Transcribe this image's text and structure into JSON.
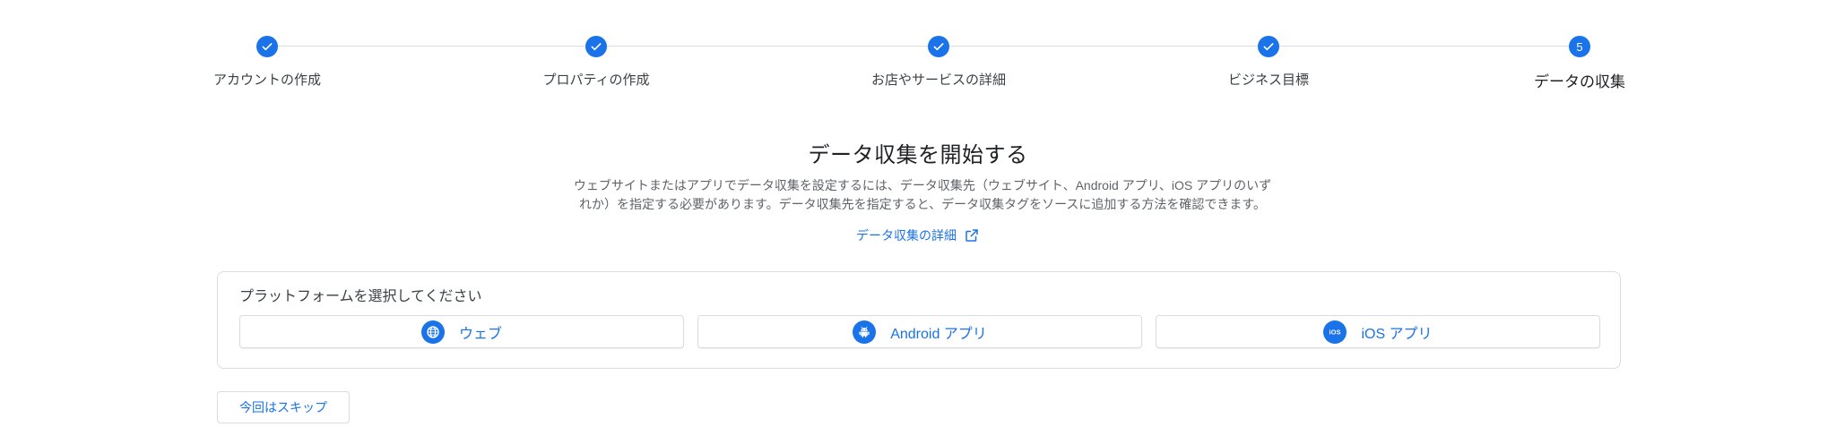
{
  "stepper": {
    "steps": [
      {
        "label": "アカウントの作成",
        "state": "done",
        "number": ""
      },
      {
        "label": "プロパティの作成",
        "state": "done",
        "number": ""
      },
      {
        "label": "お店やサービスの詳細",
        "state": "done",
        "number": ""
      },
      {
        "label": "ビジネス目標",
        "state": "done",
        "number": ""
      },
      {
        "label": "データの収集",
        "state": "current",
        "number": "5"
      }
    ]
  },
  "main": {
    "title": "データ収集を開始する",
    "description_line1": "ウェブサイトまたはアプリでデータ収集を設定するには、データ収集先（ウェブサイト、Android アプリ、iOS アプリのいず",
    "description_line2": "れか）を指定する必要があります。データ収集先を指定すると、データ収集タグをソースに追加する方法を確認できます。",
    "learn_more": "データ収集の詳細"
  },
  "platform_card": {
    "title": "プラットフォームを選択してください",
    "buttons": [
      {
        "label": "ウェブ",
        "icon": "globe-icon"
      },
      {
        "label": "Android アプリ",
        "icon": "android-icon"
      },
      {
        "label": "iOS アプリ",
        "icon": "ios-icon"
      }
    ]
  },
  "footer": {
    "skip_label": "今回はスキップ"
  },
  "colors": {
    "accent": "#1a73e8",
    "border": "#dadce0",
    "text": "#3c4043"
  }
}
